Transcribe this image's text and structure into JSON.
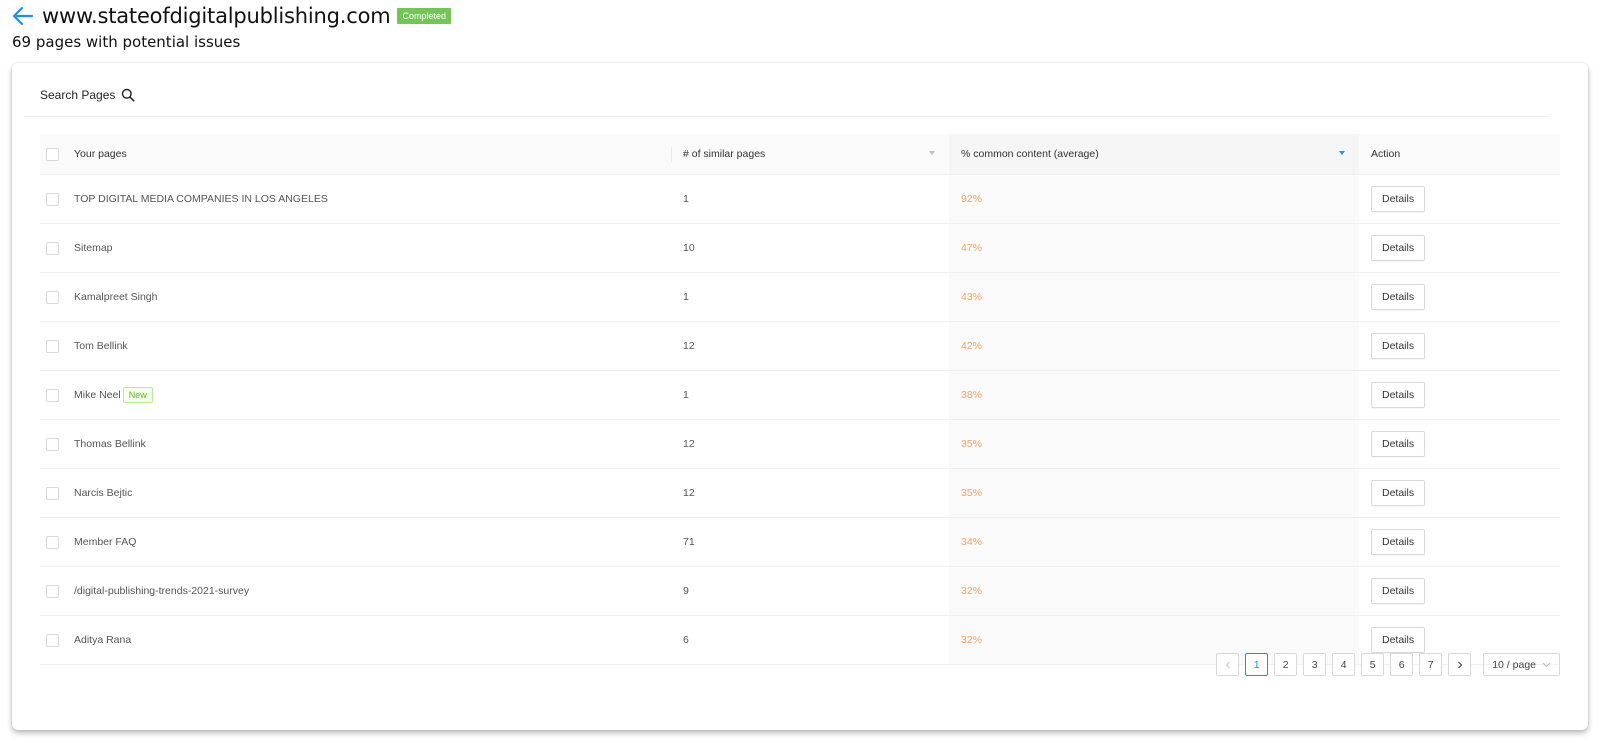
{
  "header": {
    "back_icon": "arrow-left-icon",
    "site": "www.stateofdigitalpublishing.com",
    "status": "Completed",
    "subtitle": "69 pages with potential issues",
    "accent_color": "#1890ff",
    "status_color": "#73c557"
  },
  "search": {
    "label": "Search Pages",
    "icon": "search-icon"
  },
  "table": {
    "columns": {
      "page": "Your pages",
      "similar": "# of similar pages",
      "common": "% common content (average)",
      "action": "Action"
    },
    "sorted_by": "common",
    "percent_color": "#f5a35a",
    "rows": [
      {
        "page": "TOP DIGITAL MEDIA COMPANIES IN LOS ANGELES",
        "tag": "",
        "similar": "1",
        "common": "92%",
        "action": "Details"
      },
      {
        "page": "Sitemap",
        "tag": "",
        "similar": "10",
        "common": "47%",
        "action": "Details"
      },
      {
        "page": "Kamalpreet Singh",
        "tag": "",
        "similar": "1",
        "common": "43%",
        "action": "Details"
      },
      {
        "page": "Tom Bellink",
        "tag": "",
        "similar": "12",
        "common": "42%",
        "action": "Details"
      },
      {
        "page": "Mike Neel",
        "tag": "New",
        "similar": "1",
        "common": "38%",
        "action": "Details"
      },
      {
        "page": "Thomas Bellink",
        "tag": "",
        "similar": "12",
        "common": "35%",
        "action": "Details"
      },
      {
        "page": "Narcis Bejtic",
        "tag": "",
        "similar": "12",
        "common": "35%",
        "action": "Details"
      },
      {
        "page": "Member FAQ",
        "tag": "",
        "similar": "71",
        "common": "34%",
        "action": "Details"
      },
      {
        "page": "/digital-publishing-trends-2021-survey",
        "tag": "",
        "similar": "9",
        "common": "32%",
        "action": "Details"
      },
      {
        "page": "Aditya Rana",
        "tag": "",
        "similar": "6",
        "common": "32%",
        "action": "Details"
      }
    ]
  },
  "pagination": {
    "prev_icon": "chevron-left-icon",
    "next_icon": "chevron-right-icon",
    "pages": [
      "1",
      "2",
      "3",
      "4",
      "5",
      "6",
      "7"
    ],
    "current": "1",
    "page_size": "10 / page"
  }
}
